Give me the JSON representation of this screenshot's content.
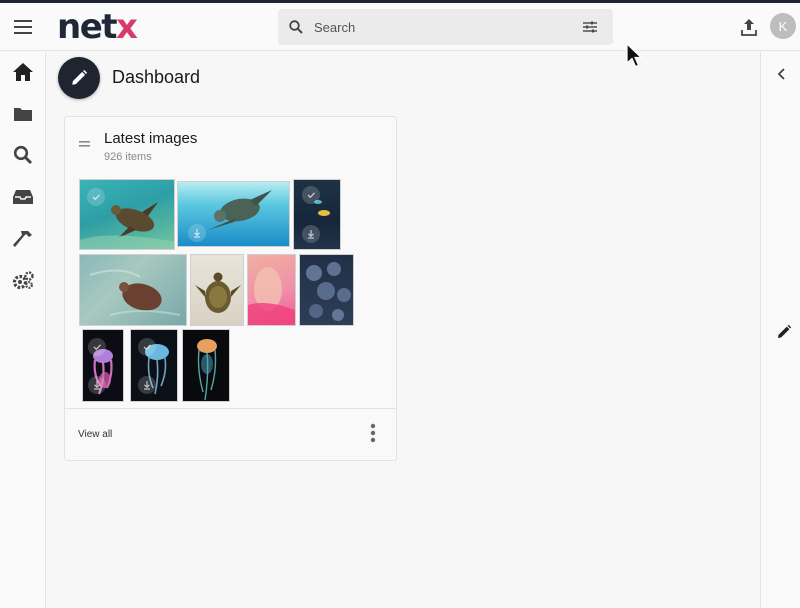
{
  "app": {
    "logo_main": "net",
    "logo_accent": "x",
    "brand_color": "#1e2838",
    "accent_color": "#d63a6e"
  },
  "topbar": {
    "menu_icon": "hamburger-icon",
    "search_placeholder": "Search",
    "search_icon": "search-icon",
    "filter_icon": "sliders-icon",
    "upload_icon": "upload-icon",
    "avatar_initial": "K"
  },
  "sidebar": {
    "items": [
      {
        "name": "home",
        "icon": "home-icon"
      },
      {
        "name": "folders",
        "icon": "folder-icon"
      },
      {
        "name": "search",
        "icon": "search-icon"
      },
      {
        "name": "inbox",
        "icon": "inbox-icon"
      },
      {
        "name": "tools",
        "icon": "hammer-icon"
      },
      {
        "name": "settings",
        "icon": "gears-icon"
      }
    ]
  },
  "page": {
    "title": "Dashboard",
    "edit_icon": "pencil-icon"
  },
  "widget": {
    "title": "Latest images",
    "count": "926 items",
    "view_all": "View all",
    "more_icon": "kebab-icon",
    "drag_icon": "drag-handle-icon",
    "images": [
      {
        "name": "turtle-reef"
      },
      {
        "name": "turtle-swimming"
      },
      {
        "name": "fish-dark"
      },
      {
        "name": "turtle-shallow-water"
      },
      {
        "name": "turtle-on-sand"
      },
      {
        "name": "pink-portrait"
      },
      {
        "name": "jellyfish-cluster"
      },
      {
        "name": "jellyfish-purple"
      },
      {
        "name": "jellyfish-blue"
      },
      {
        "name": "jellyfish-orange"
      }
    ]
  },
  "rightpanel": {
    "collapse_icon": "chevron-left-icon",
    "edit_icon": "pencil-icon"
  }
}
